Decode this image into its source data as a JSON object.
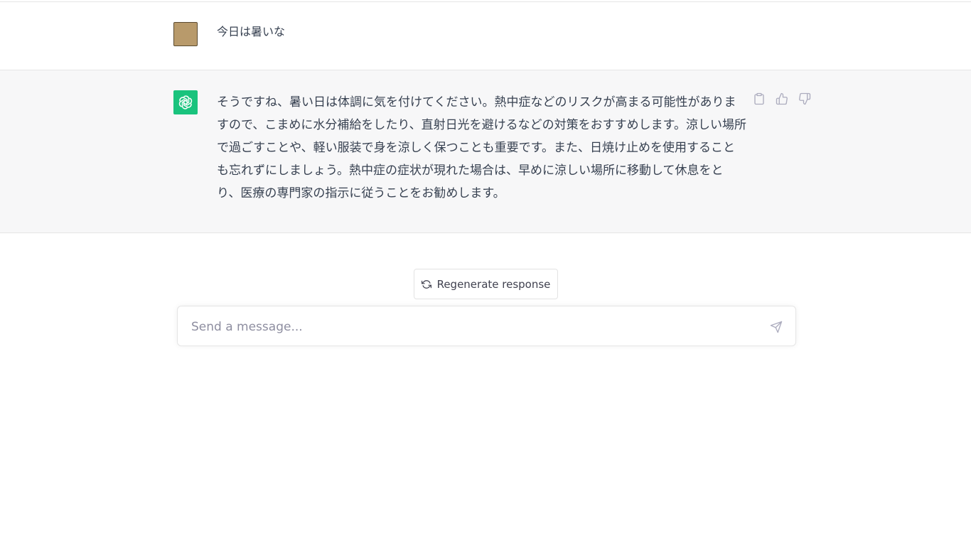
{
  "conversation": {
    "user_message": "今日は暑いな",
    "assistant_message": "そうですね、暑い日は体調に気を付けてください。熱中症などのリスクが高まる可能性がありますので、こまめに水分補給をしたり、直射日光を避けるなどの対策をおすすめします。涼しい場所で過ごすことや、軽い服装で身を涼しく保つことも重要です。また、日焼け止めを使用することも忘れずにしましょう。熱中症の症状が現れた場合は、早めに涼しい場所に移動して休息をとり、医療の専門家の指示に従うことをお勧めします。"
  },
  "controls": {
    "regenerate_label": "Regenerate response",
    "input_placeholder": "Send a message..."
  },
  "icons": {
    "copy": "clipboard-icon",
    "thumbs_up": "thumbs-up-icon",
    "thumbs_down": "thumbs-down-icon",
    "regenerate": "refresh-icon",
    "send": "paper-plane-icon",
    "assistant_logo": "openai-logo-icon"
  },
  "colors": {
    "assistant_avatar": "#19c37d",
    "user_avatar": "#b89a6b",
    "assistant_row_bg": "#f7f7f8"
  }
}
